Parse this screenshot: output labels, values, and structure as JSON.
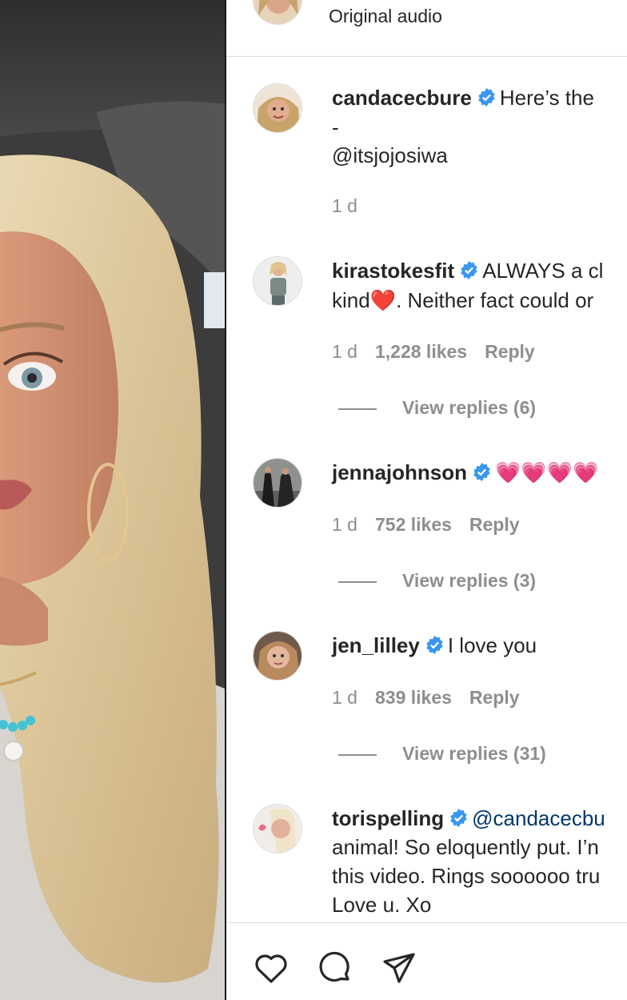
{
  "audio": {
    "label": "Original audio"
  },
  "comments": [
    {
      "username": "candacecbure",
      "text": "Here’s the",
      "line2": "-",
      "line3": "@itsjojosiwa",
      "time": "1 d"
    },
    {
      "username": "kirastokesfit",
      "text": "ALWAYS a cl",
      "line2": "kind❤️. Neither fact could or",
      "time": "1 d",
      "likes": "1,228 likes",
      "reply": "Reply",
      "view_replies": "View replies (6)"
    },
    {
      "username": "jennajohnson",
      "text": "💗💗💗💗",
      "time": "1 d",
      "likes": "752 likes",
      "reply": "Reply",
      "view_replies": "View replies (3)"
    },
    {
      "username": "jen_lilley",
      "text": "I love you",
      "time": "1 d",
      "likes": "839 likes",
      "reply": "Reply",
      "view_replies": "View replies (31)"
    },
    {
      "username": "torispelling",
      "text": "@candacecbu",
      "line2": "animal! So eloquently put. I’n",
      "line3": "this video. Rings soooooo tru",
      "line4": "Love u. Xo"
    }
  ],
  "actions": {
    "like_icon": "heart-icon",
    "comment_icon": "comment-icon",
    "share_icon": "send-icon"
  },
  "colors": {
    "verified": "#3897f0",
    "mention": "#00376b",
    "secondary_text": "#8e8e8e"
  }
}
